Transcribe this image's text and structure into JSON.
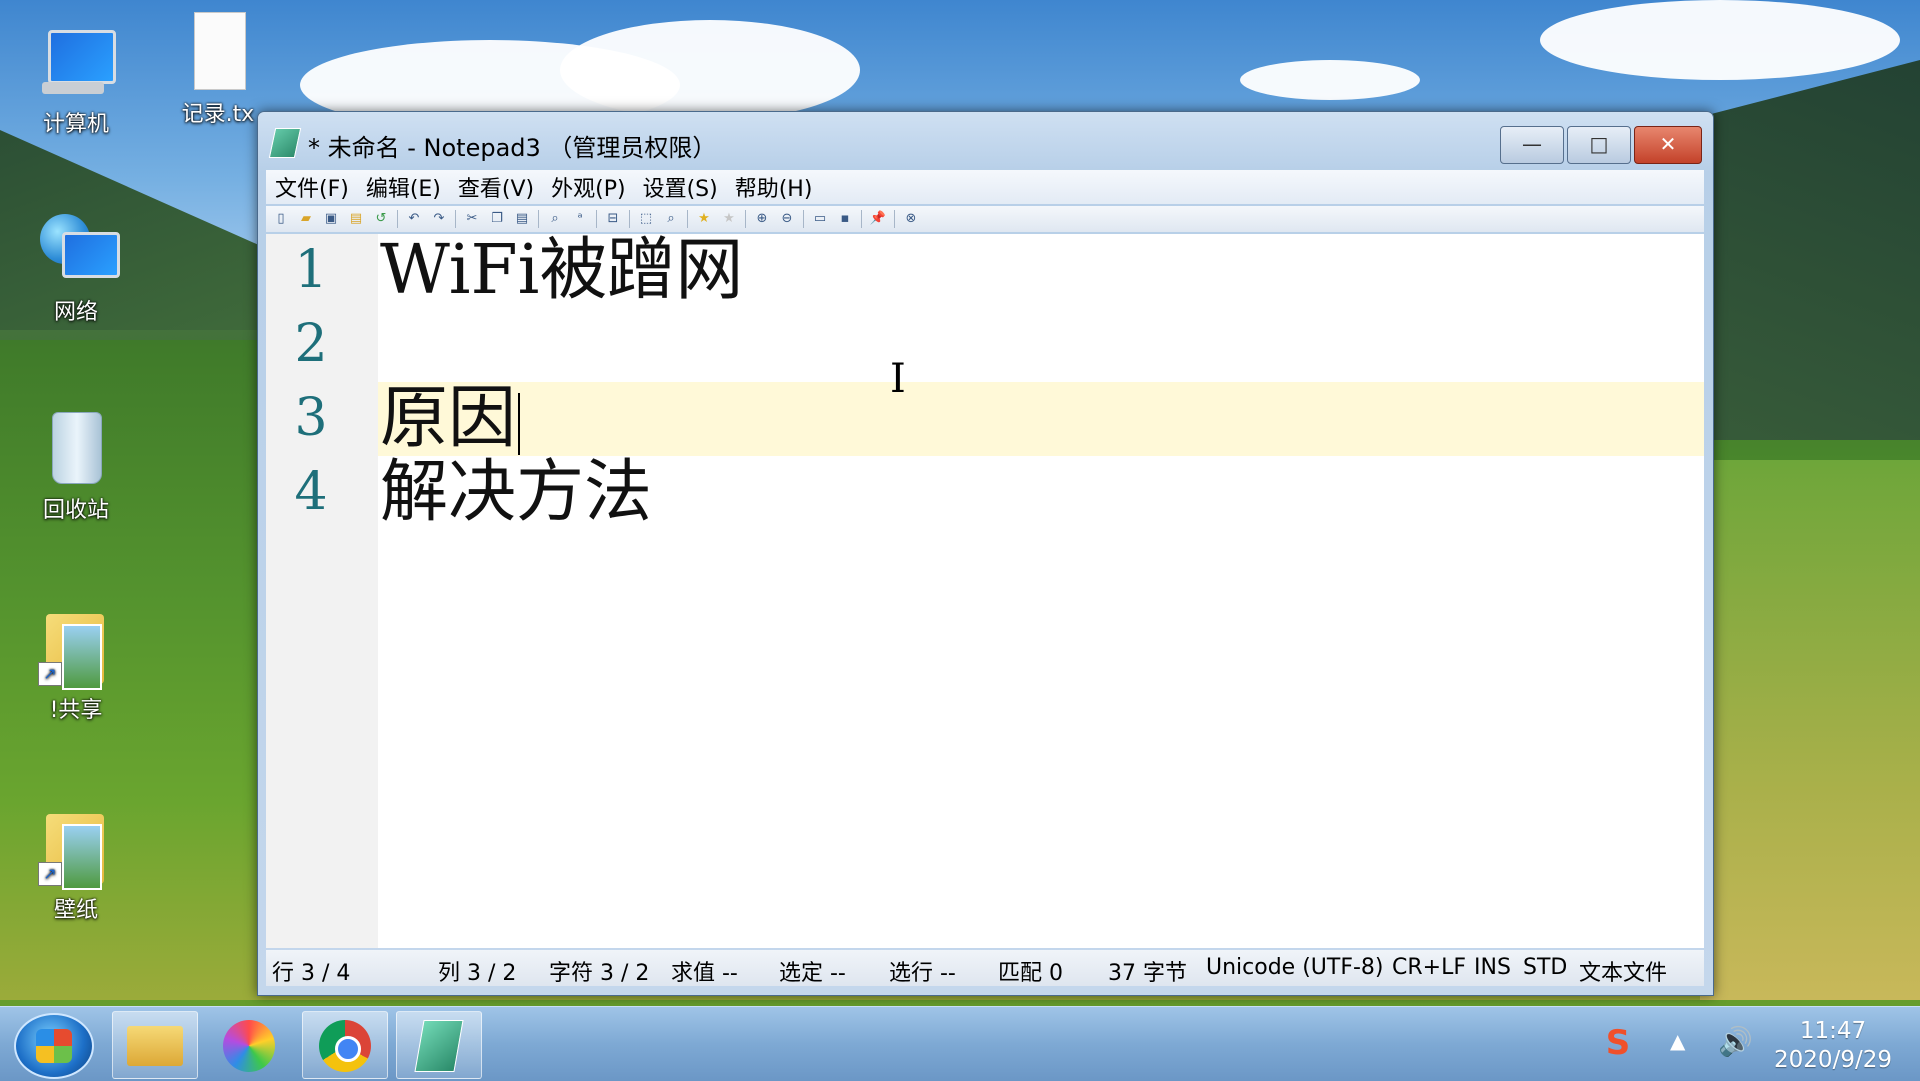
{
  "desktop": {
    "icons": [
      {
        "label": "计算机"
      },
      {
        "label": "记录.tx"
      },
      {
        "label": "网络"
      },
      {
        "label": "回收站"
      },
      {
        "label": "!共享"
      },
      {
        "label": "壁纸"
      }
    ]
  },
  "window": {
    "title": "* 未命名 - Notepad3 （管理员权限）",
    "controls": {
      "minimize": "—",
      "maximize": "□",
      "close": "✕"
    }
  },
  "menu": [
    {
      "label": "文件(F)"
    },
    {
      "label": "编辑(E)"
    },
    {
      "label": "查看(V)"
    },
    {
      "label": "外观(P)"
    },
    {
      "label": "设置(S)"
    },
    {
      "label": "帮助(H)"
    }
  ],
  "toolbar": {
    "icons": [
      "new-icon",
      "open-icon",
      "save-icon",
      "save-as-icon",
      "revert-icon",
      "undo-icon",
      "redo-icon",
      "cut-icon",
      "copy-icon",
      "paste-icon",
      "find-icon",
      "replace-icon",
      "wrap-icon",
      "select-icon",
      "zoom-find-icon",
      "favorite-icon",
      "add-favorite-icon",
      "zoom-in-icon",
      "zoom-out-icon",
      "scheme-icon",
      "console-icon",
      "pin-icon",
      "exit-icon"
    ]
  },
  "editor": {
    "lines": [
      {
        "number": "1",
        "text": "WiFi被蹭网"
      },
      {
        "number": "2",
        "text": ""
      },
      {
        "number": "3",
        "text": "原因"
      },
      {
        "number": "4",
        "text": "解决方法"
      }
    ],
    "current_line": 3,
    "cursor_glyph": "I"
  },
  "status": {
    "line": "行 3 / 4",
    "col": "列 3 / 2",
    "char": "字符 3 / 2",
    "value": "求值 --",
    "selected": "选定 --",
    "sel_lines": "选行 --",
    "match": "匹配 0",
    "bytes": "37 字节",
    "encoding": "Unicode (UTF-8)",
    "eol": "CR+LF",
    "ins": "INS",
    "std": "STD",
    "filetype": "文本文件"
  },
  "taskbar": {
    "apps": [
      "explorer",
      "360-browser",
      "chrome",
      "notepad3"
    ],
    "tray_ime": "S",
    "tray_up": "▲",
    "tray_volume": "🔊",
    "time": "11:47",
    "date": "2020/9/29"
  }
}
